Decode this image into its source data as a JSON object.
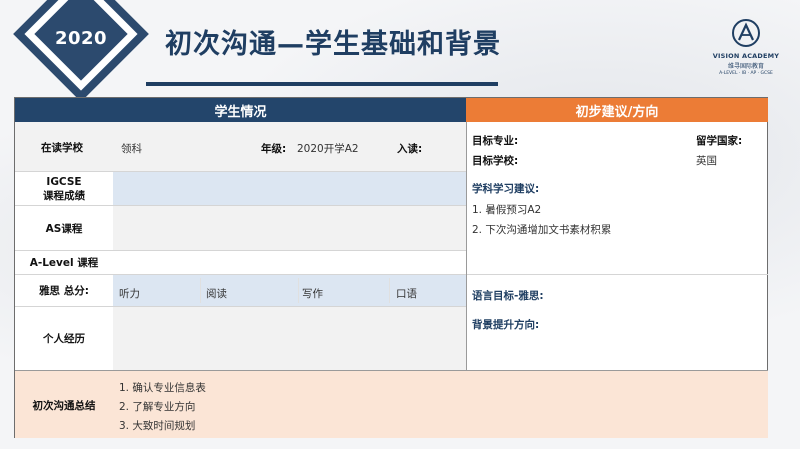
{
  "header": {
    "year": "2020",
    "title": "初次沟通—学生基础和背景",
    "brand_name": "VISION ACADEMY",
    "brand_cn": "维寻国际教育",
    "brand_sub": "A-LEVEL · IB · AP · GCSE"
  },
  "colors": {
    "navy": "#23456b",
    "orange": "#ec7c36",
    "peach": "#fbe5d6",
    "light_blue": "#dce6f2"
  },
  "left": {
    "header": "学生情况",
    "school_label": "在读学校",
    "school_value": "领科",
    "grade_label": "年级:",
    "grade_value": "2020开学A2",
    "enroll_label": "入读:",
    "igcse_label_1": "IGCSE",
    "igcse_label_2": "课程成绩",
    "as_label": "AS课程",
    "alevel_label": "A-Level 课程",
    "ielts_label": "雅思  总分:",
    "ielts_parts": [
      "听力",
      "阅读",
      "写作",
      "口语"
    ],
    "experience_label": "个人经历"
  },
  "right": {
    "header": "初步建议/方向",
    "target_major_label": "目标专业:",
    "target_school_label": "目标学校:",
    "country_label": "留学国家:",
    "country_value": "英国",
    "subject_advice_label": "学科学习建议:",
    "subject_advice_items": [
      "1. 暑假预习A2",
      "2. 下次沟通增加文书素材积累"
    ],
    "language_goal_label": "语言目标-雅思:",
    "background_label": "背景提升方向:"
  },
  "summary": {
    "label": "初次沟通总结",
    "items": [
      "1. 确认专业信息表",
      "2. 了解专业方向",
      "3. 大致时间规划"
    ]
  }
}
